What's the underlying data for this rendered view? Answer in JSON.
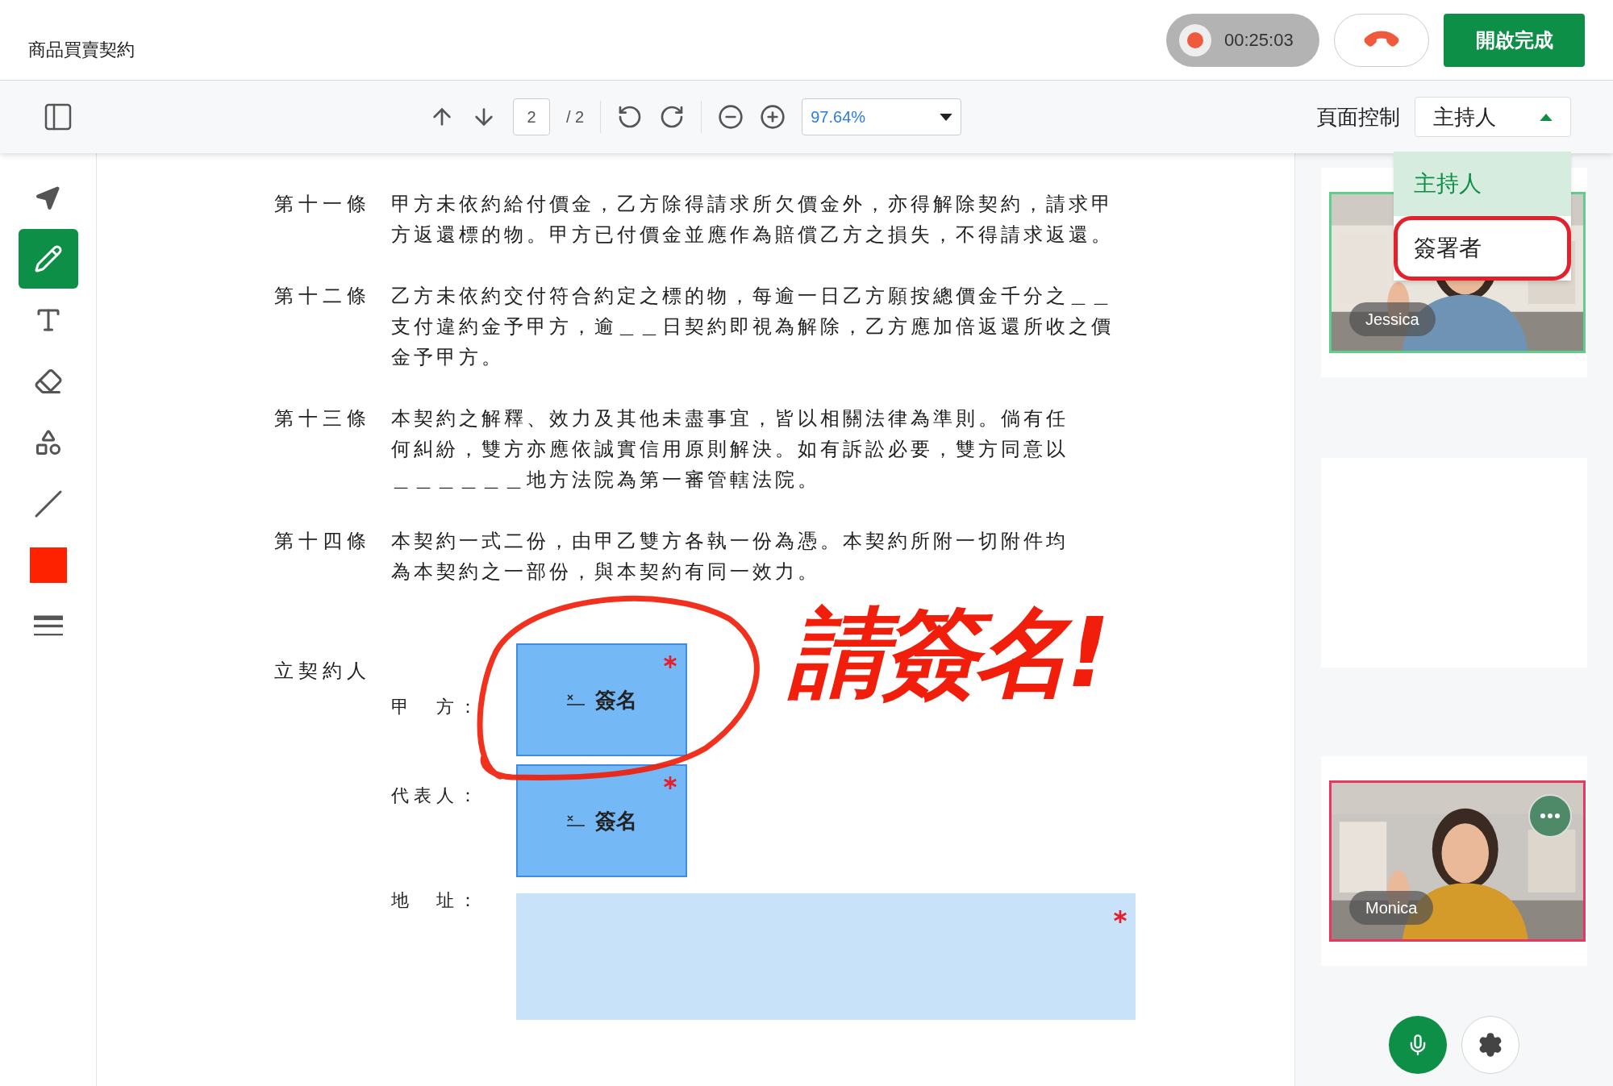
{
  "document": {
    "title": "商品買賣契約"
  },
  "recording": {
    "on": true,
    "time": "00:25:03"
  },
  "finish_button": "開啟完成",
  "toolbar": {
    "page": "2",
    "page_total": "/ 2",
    "zoom": "97.64%"
  },
  "page_control": {
    "label": "頁面控制",
    "role": "主持人",
    "expanded": true,
    "options": [
      {
        "label": "主持人",
        "selected": true,
        "highlighted": false
      },
      {
        "label": "簽署者",
        "selected": false,
        "highlighted": true
      }
    ]
  },
  "tools": [
    {
      "kind": "select",
      "selected": false
    },
    {
      "kind": "pen",
      "selected": true
    },
    {
      "kind": "text",
      "selected": false
    },
    {
      "kind": "eraser",
      "selected": false
    },
    {
      "kind": "shapes",
      "selected": false
    },
    {
      "kind": "line",
      "selected": false
    },
    {
      "kind": "color",
      "selected": false,
      "color": "#ff2200"
    },
    {
      "kind": "stroke",
      "selected": false
    }
  ],
  "articles": [
    {
      "label": "第十一條",
      "lines": [
        "甲方未依約給付價金，乙方除得請求所欠價金外，亦得解除契約，請求甲",
        "方返還標的物。甲方已付價金並應作為賠償乙方之損失，不得請求返還。"
      ]
    },
    {
      "label": "第十二條",
      "lines": [
        "乙方未依約交付符合約定之標的物，每逾一日乙方願按總價金千分之＿＿",
        "支付違約金予甲方，逾＿＿日契約即視為解除，乙方應加倍返還所收之價",
        "金予甲方。"
      ]
    },
    {
      "label": "第十三條",
      "lines": [
        "本契約之解釋、效力及其他未盡事宜，皆以相關法律為準則。倘有任",
        "何糾紛，雙方亦應依誠實信用原則解決。如有訴訟必要，雙方同意以",
        "＿＿＿＿＿＿地方法院為第一審管轄法院。"
      ]
    },
    {
      "label": "第十四條",
      "lines": [
        "本契約一式二份，由甲乙雙方各執一份為憑。本契約所附一切附件均",
        "為本契約之一部份，與本契約有同一效力。"
      ]
    }
  ],
  "signatories": {
    "label": "立契約人",
    "fields": [
      {
        "kind": "signature",
        "label": "甲　方：",
        "text": "簽名",
        "required": true
      },
      {
        "kind": "signature",
        "label": "代表人：",
        "text": "簽名",
        "required": true
      },
      {
        "kind": "text",
        "label": "地　址：",
        "required": true
      }
    ]
  },
  "annotation": {
    "handwriting": "請簽名!"
  },
  "participants": [
    {
      "name": "Jessica",
      "color": "#5fce8a",
      "menu": false
    },
    {
      "name": "Monica",
      "color": "#e8385f",
      "menu": true
    }
  ],
  "mic": {
    "on": true
  }
}
